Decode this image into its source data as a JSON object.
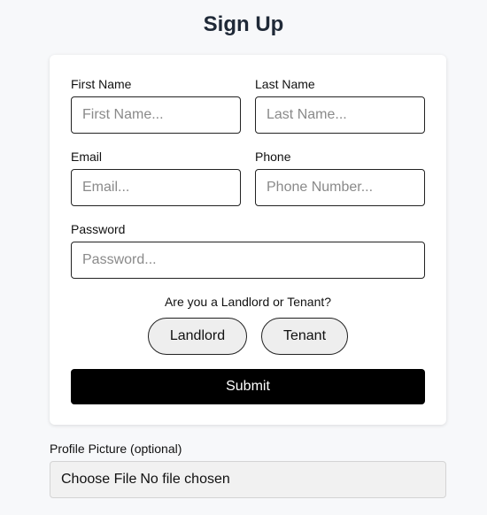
{
  "page": {
    "title": "Sign Up"
  },
  "form": {
    "first_name": {
      "label": "First Name",
      "placeholder": "First Name...",
      "value": ""
    },
    "last_name": {
      "label": "Last Name",
      "placeholder": "Last Name...",
      "value": ""
    },
    "email": {
      "label": "Email",
      "placeholder": "Email...",
      "value": ""
    },
    "phone": {
      "label": "Phone",
      "placeholder": "Phone Number...",
      "value": ""
    },
    "password": {
      "label": "Password",
      "placeholder": "Password...",
      "value": ""
    },
    "role_question": "Are you a Landlord or Tenant?",
    "role_options": [
      "Landlord",
      "Tenant"
    ],
    "submit_label": "Submit"
  },
  "profile_picture": {
    "label": "Profile Picture (optional)",
    "choose_label": "Choose File",
    "status": "No file chosen"
  }
}
